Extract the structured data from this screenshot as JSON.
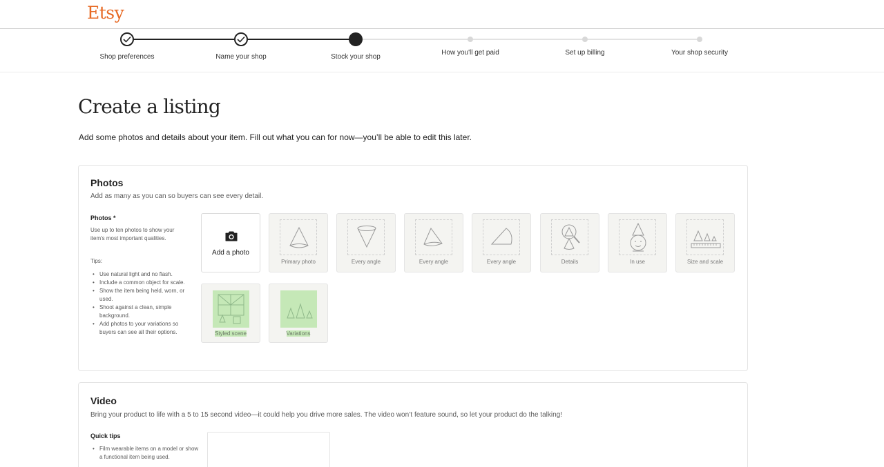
{
  "brand": {
    "logo": "Etsy",
    "accent_color": "#e76a25"
  },
  "stepper": {
    "steps": [
      {
        "label": "Shop preferences",
        "state": "done"
      },
      {
        "label": "Name your shop",
        "state": "done"
      },
      {
        "label": "Stock your shop",
        "state": "current"
      },
      {
        "label": "How you'll get paid",
        "state": "todo"
      },
      {
        "label": "Set up billing",
        "state": "todo"
      },
      {
        "label": "Your shop security",
        "state": "todo"
      }
    ]
  },
  "page": {
    "title": "Create a listing",
    "subtitle": "Add some photos and details about your item. Fill out what you can for now—you’ll be able to edit this later."
  },
  "photos": {
    "title": "Photos",
    "description": "Add as many as you can so buyers can see every detail.",
    "field_label": "Photos *",
    "help_text": "Use up to ten photos to show your item's most important qualities.",
    "tips_heading": "Tips:",
    "tips": [
      "Use natural light and no flash.",
      "Include a common object for scale.",
      "Show the item being held, worn, or used.",
      "Shoot against a clean, simple background.",
      "Add photos to your variations so buyers can see all their options."
    ],
    "add_photo_label": "Add a photo",
    "slots": [
      {
        "label": "Primary photo",
        "icon": "cone-icon"
      },
      {
        "label": "Every angle",
        "icon": "cone-inverted-icon"
      },
      {
        "label": "Every angle",
        "icon": "cone-tilted-icon"
      },
      {
        "label": "Every angle",
        "icon": "cone-side-icon"
      },
      {
        "label": "Details",
        "icon": "magnifier-cone-icon"
      },
      {
        "label": "In use",
        "icon": "cone-on-head-icon"
      },
      {
        "label": "Size and scale",
        "icon": "cones-ruler-icon"
      },
      {
        "label": "Styled scene",
        "icon": "styled-scene-icon",
        "highlight_color": "#c5e8b7"
      },
      {
        "label": "Variations",
        "icon": "cone-variations-icon",
        "highlight_color": "#c5e8b7"
      }
    ]
  },
  "video": {
    "title": "Video",
    "description": "Bring your product to life with a 5 to 15 second video—it could help you drive more sales. The video won’t feature sound, so let your product do the talking!",
    "tips_label": "Quick tips",
    "tips": [
      "Film wearable items on a model or show a functional item being used."
    ]
  }
}
